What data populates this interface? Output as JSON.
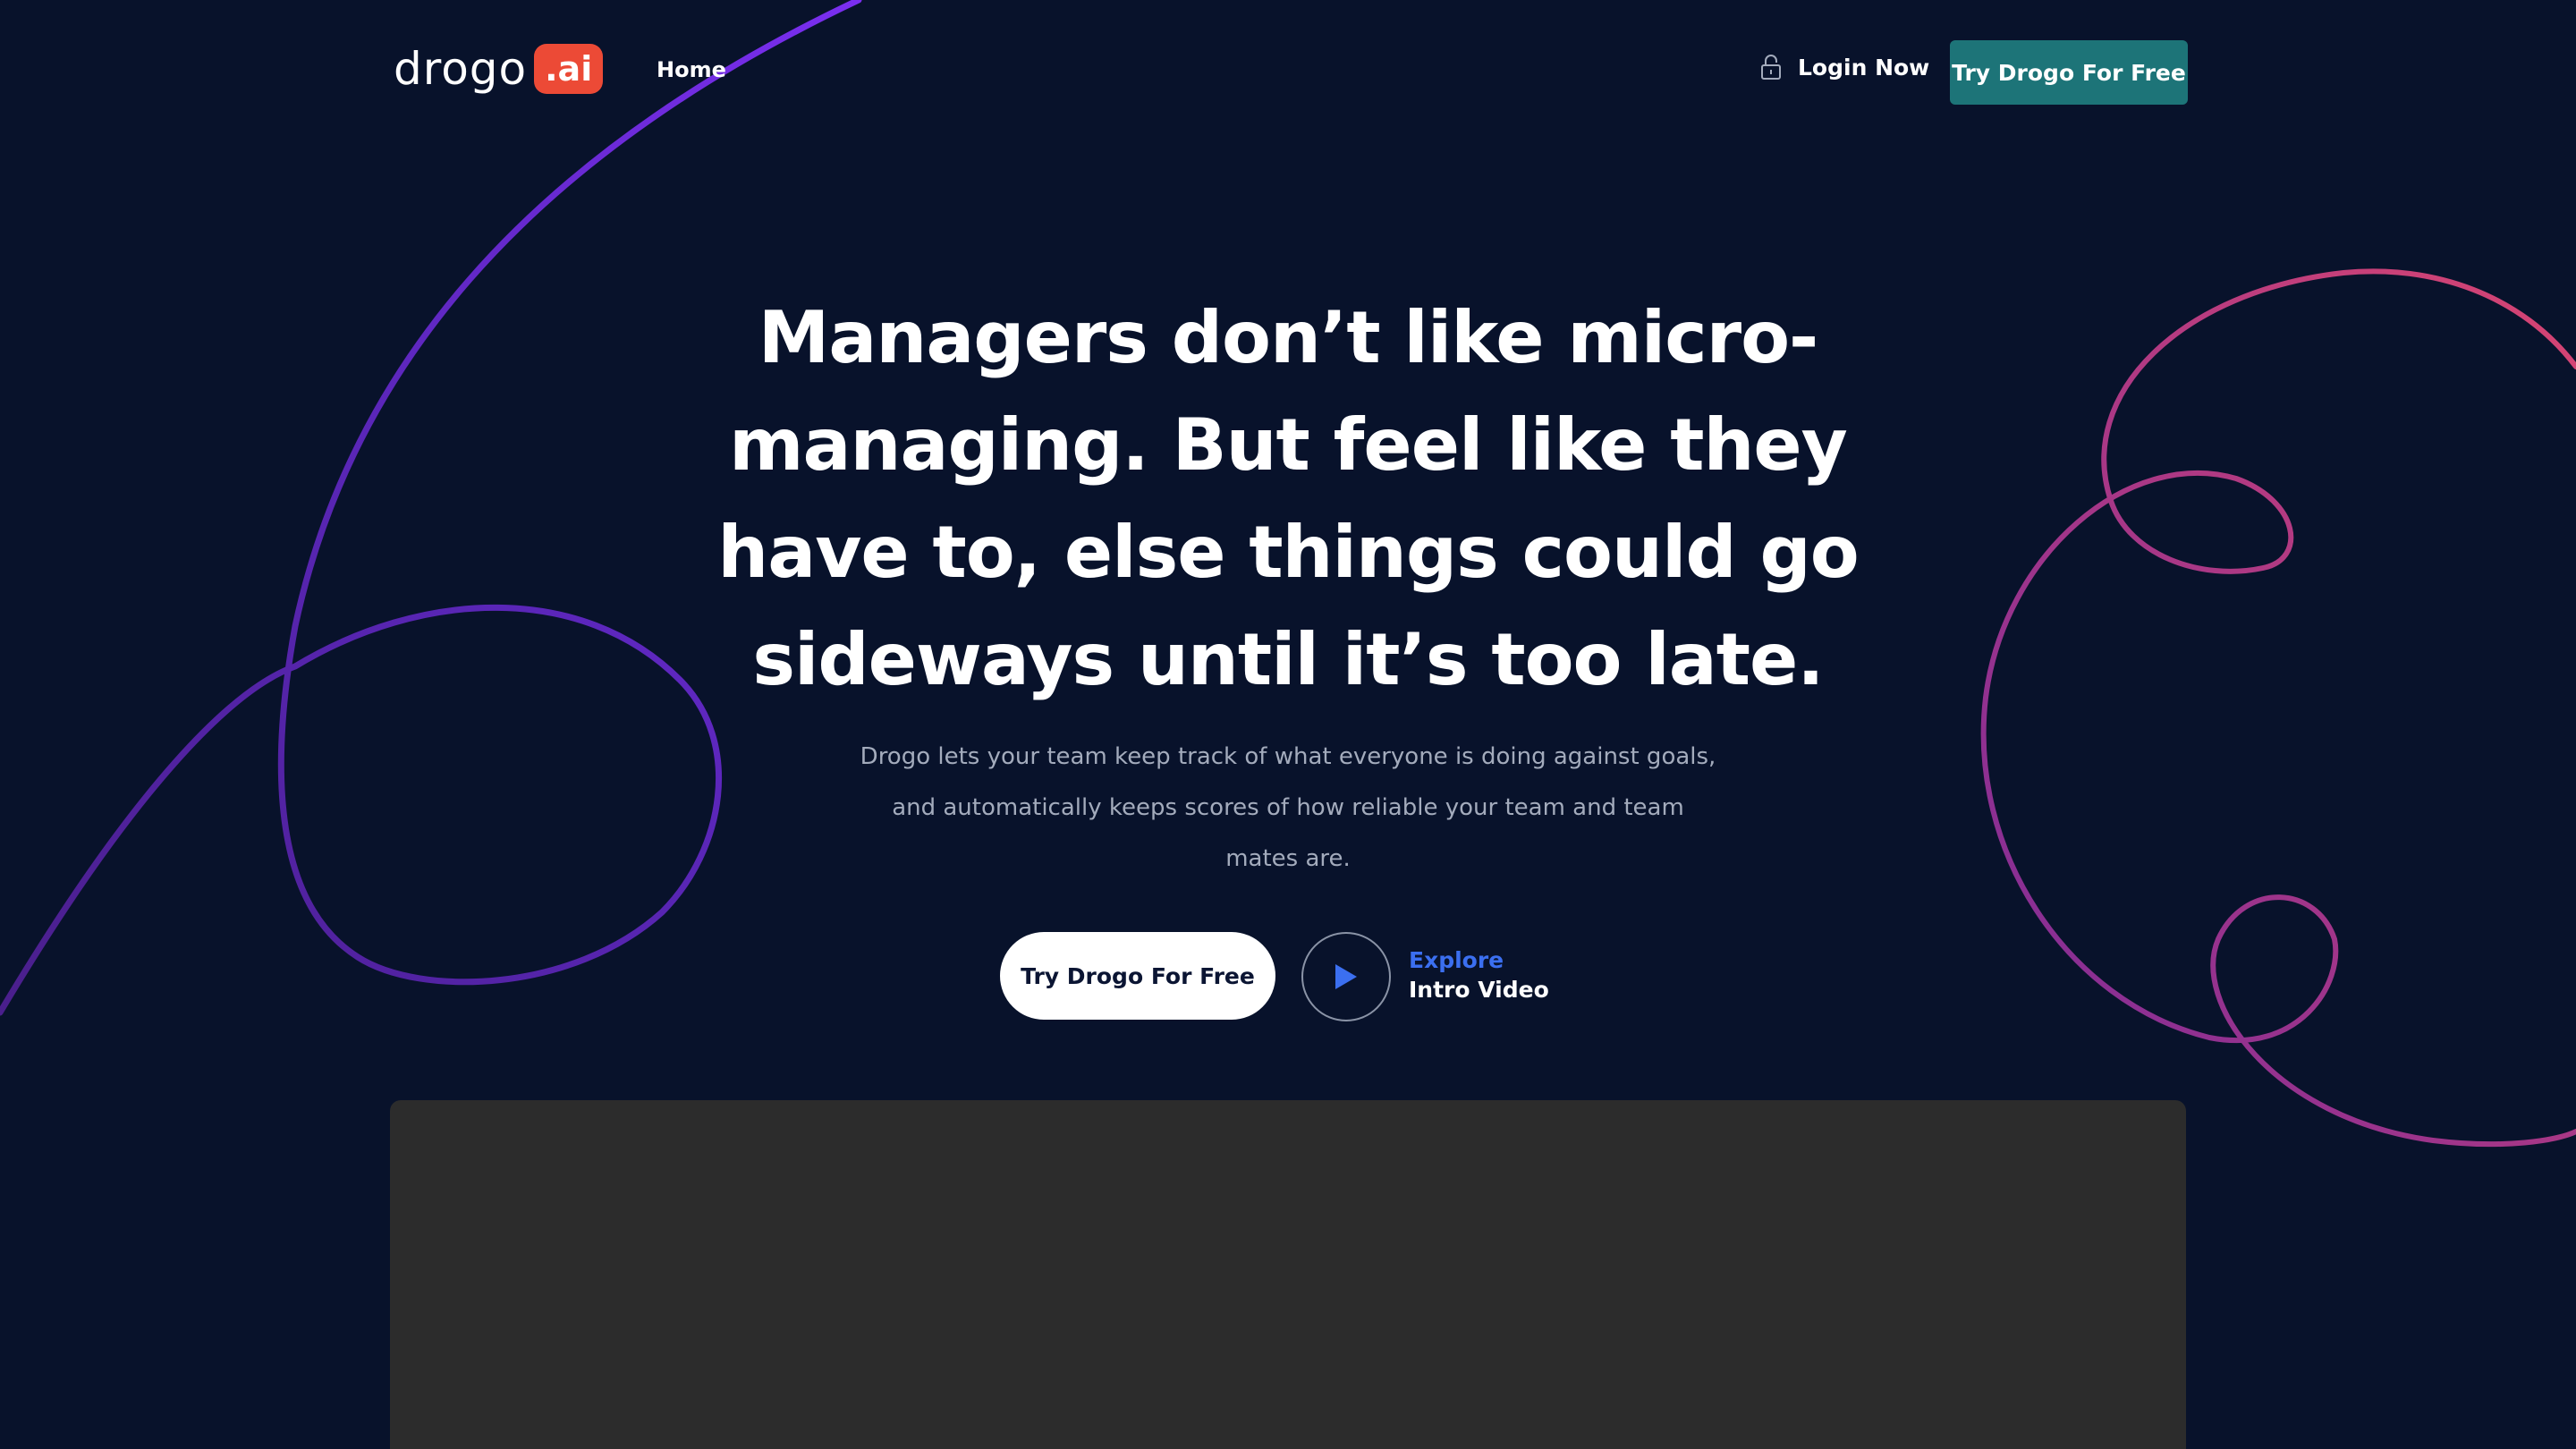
{
  "header": {
    "logo_text": "drogo",
    "logo_badge": ".ai",
    "nav_home": "Home",
    "login_label": "Login Now",
    "cta_label": "Try Drogo For Free"
  },
  "hero": {
    "headline": "Managers don’t like micro-managing. But feel like they have to, else things could go sideways until it’s too late.",
    "subtext": "Drogo lets your team keep track of what everyone is doing against goals, and automatically keeps scores of how reliable your team and team mates are.",
    "cta_primary": "Try Drogo For Free",
    "video_label_top": "Explore",
    "video_label_bottom": "Intro Video"
  },
  "colors": {
    "background": "#08122b",
    "accent_teal": "#1d7478",
    "logo_badge": "#ec4a36",
    "link_blue": "#3b6ff0",
    "preview_panel": "#2c2c2c",
    "swirl_left": "#6a2be0",
    "swirl_right": "#c43a7e"
  },
  "icons": {
    "login": "lock-icon",
    "video": "play-icon"
  }
}
